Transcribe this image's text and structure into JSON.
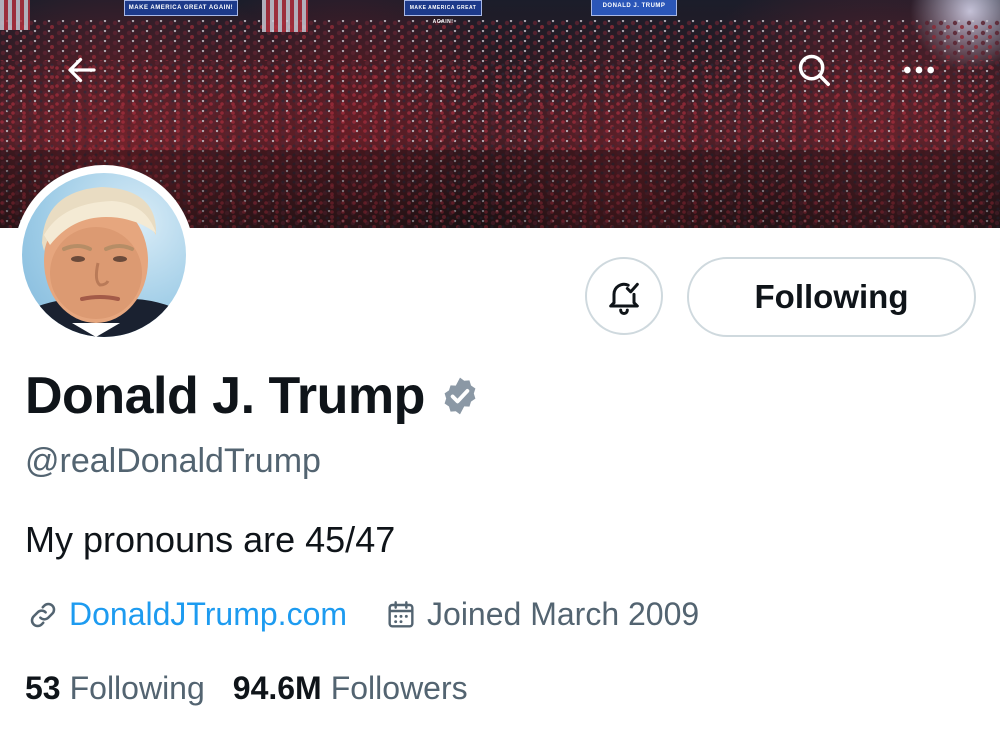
{
  "banner": {
    "signs": [
      "MAKE AMERICA GREAT AGAIN!",
      "MAKE AMERICA GREAT AGAIN!",
      "DONALD J. TRUMP"
    ]
  },
  "top_bar": {
    "back_icon": "arrow-left-icon",
    "search_icon": "search-icon",
    "more_icon": "more-horizontal-icon"
  },
  "actions": {
    "notify_icon": "bell-check-icon",
    "follow_label": "Following"
  },
  "profile": {
    "name": "Donald J. Trump",
    "verified_icon": "verified-badge-icon",
    "verified_color": "#8b98a5",
    "handle": "@realDonaldTrump",
    "bio": "My pronouns are 45/47",
    "website": "DonaldJTrump.com",
    "joined": "Joined March 2009",
    "following_count": "53",
    "following_label": "Following",
    "followers_count": "94.6M",
    "followers_label": "Followers"
  },
  "colors": {
    "link": "#1d9bf0",
    "secondary_text": "#536471",
    "primary_text": "#0f1419",
    "border": "#cfd9de"
  }
}
